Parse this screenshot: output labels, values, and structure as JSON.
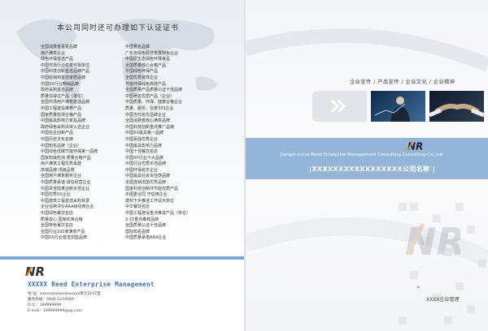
{
  "left_page": {
    "title": "本公司同时还可办理如下认证证书",
    "certs_col1": [
      "全国消费者喜爱品牌",
      "用户满意企业",
      "绿色环保首选产品",
      "中国市场行业信誉可靠单位",
      "中国科技创新首选品牌产品",
      "中国经销商首选家居品牌",
      "中国XX行业畅销品牌",
      "政府采购首选品牌",
      "质量信得过产品（单位）",
      "全国市场用户满意首选品牌",
      "中国工程建设推荐产品",
      "国家质量检测合格产品",
      "中国最具影响力家具品牌",
      "政府绿色采购清单入选企业",
      "中国自主创新产品",
      "中国历史文化名牌",
      "中国知名品牌（企业）",
      "中国绿色低碳节能环保第一品牌",
      "国家权威检测·质量合格产品",
      "用户满意工程优秀承建",
      "高端品牌·顶级品牌",
      "全国用户满意服务企业",
      "中国质量承诺·诚信经营企业",
      "中国百佳改革创新示范企业",
      "中国优秀XX企业",
      "中国建筑工程首选采购目录",
      "企业信用评价AAA级信用企业",
      "中国绿色餐饮名店",
      "质量放心·国家标准合格",
      "全国特色餐饮名店",
      "全国行业100家满意产品",
      "中国XX行业首选加盟品牌"
    ],
    "certs_col2": [
      "中国著名品牌",
      "广东省绿色经济发展特色企业",
      "中国原生态绿色环保食品",
      "全国质量放心合格产品",
      "中国绿色环保产品",
      "全国优秀装饰企业",
      "节能环保绿色高效产品",
      "全国质量产品质量公证十佳品牌",
      "中国著名优质产品（企业）",
      "中国质量、环保、健康合格企业",
      "质量、服务、信誉333企业",
      "中国当代名优品牌企业",
      "全国消费者放心满意品牌",
      "中国科技创新重点推广品牌",
      "中国XX最具第一品牌",
      "中国百强优秀企业",
      "中国最具影响力品牌",
      "中国十佳餐饮名店",
      "中国XX行业十大品牌",
      "中国行业优秀示范品牌",
      "中国环保名优企业",
      "中国最具社会责任感品牌",
      "全国连锁加盟优秀品牌",
      "国家科技创新环节能优质产品",
      "中国重合同 守信用企业",
      "建材下乡推进工作试点单位",
      "中华餐饮名店",
      "中国工程建设重点推进产品（单位）",
      "3.15重点推荐品牌",
      "全国质量公证十佳品牌",
      "国际知名品牌",
      "中国质量承诺AAA企业"
    ],
    "footer": {
      "logo_text": "NR",
      "company_en": "XXXXX Reed Enterprise Management",
      "address": "地 址：xxxxxxxxxxxxxxxxxx单元2107室",
      "hotline": "服务热线：0000-1234569",
      "qq": "Q Q ：199999999",
      "email": "E-mail：199999999@qq.com"
    }
  },
  "right_page": {
    "tagline": "企业宣传 / 产品宣传 / 企业文化 / 企业精神",
    "band": {
      "logo_text": "NR",
      "company_en": "Jiangxi xxxxx Reed Enterprise Management Consulting Consulting Co.,Ltd",
      "company_cn": "|XXXXXXXXXXXXXXXXX公司名称 |"
    },
    "big_logo_text": "NR",
    "management_label": "XXXX企业管理"
  },
  "colors": {
    "accent_blue": "#94b4d8",
    "text_blue": "#3d6fb5",
    "logo_orange": "#e08a2c"
  }
}
